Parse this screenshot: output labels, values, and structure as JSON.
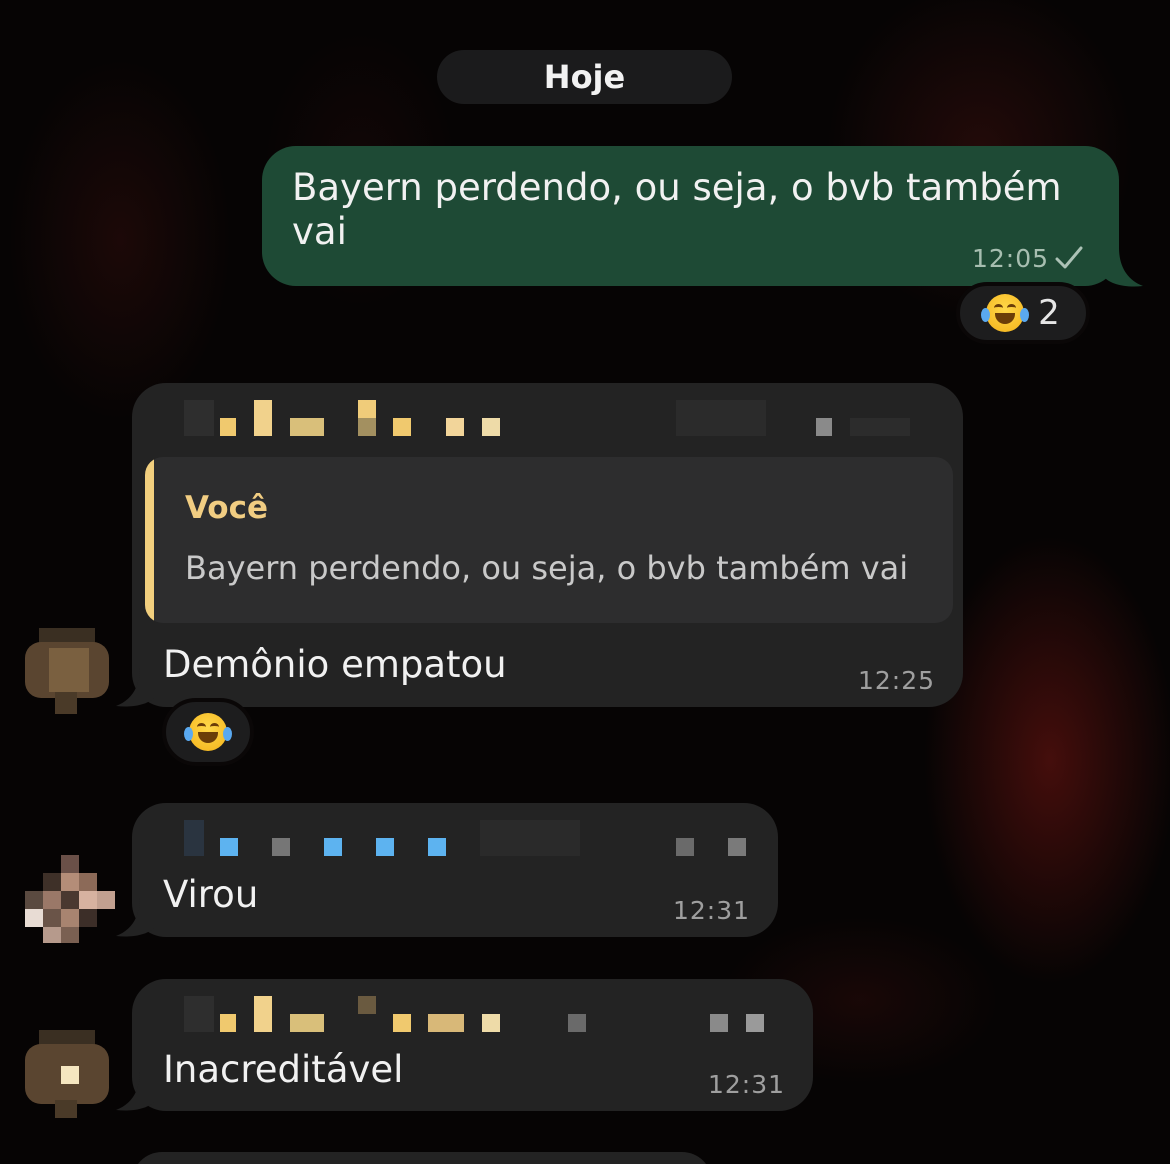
{
  "date_separator": "Hoje",
  "messages": [
    {
      "direction": "outgoing",
      "lines": [
        "Bayern perdendo, ou seja, o bvb também",
        "vai"
      ],
      "time": "12:05",
      "status": "sent-check-icon",
      "reaction": {
        "emoji": "face-with-tears-of-joy",
        "count": "2"
      }
    },
    {
      "direction": "incoming",
      "sender": "redacted",
      "reply_to": {
        "author": "Você",
        "text": "Bayern perdendo, ou seja, o bvb também vai"
      },
      "text": "Demônio empatou",
      "time": "12:25",
      "reaction": {
        "emoji": "face-with-tears-of-joy",
        "count": ""
      }
    },
    {
      "direction": "incoming",
      "sender": "redacted",
      "text": "Virou",
      "time": "12:31"
    },
    {
      "direction": "incoming",
      "sender": "redacted",
      "text": "Inacreditável",
      "time": "12:31"
    }
  ],
  "colors": {
    "outgoing_bubble": "#1e4a35",
    "incoming_bubble": "#232323",
    "quote_accent": "#f2cf7e",
    "sender_name_1": "#f0c96e",
    "sender_name_2": "#5db3f0"
  }
}
